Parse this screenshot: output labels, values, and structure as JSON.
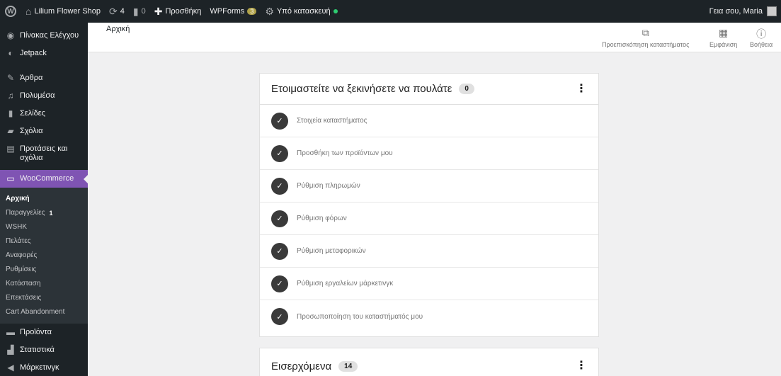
{
  "adminbar": {
    "site_name": "Lilium Flower Shop",
    "updates_count": "4",
    "comments_count": "0",
    "new_label": "Προσθήκη",
    "wpforms_label": "WPForms",
    "wpforms_count": "3",
    "maintenance_label": "Υπό κατασκευή",
    "greeting": "Γεια σου, Maria"
  },
  "sidebar": {
    "items_top": [
      {
        "label": "Πίνακας Ελέγχου",
        "icon": "dashboard-icon"
      },
      {
        "label": "Jetpack",
        "icon": "jetpack-icon"
      }
    ],
    "items_mid": [
      {
        "label": "Άρθρα",
        "icon": "pin-icon"
      },
      {
        "label": "Πολυμέσα",
        "icon": "media-icon"
      },
      {
        "label": "Σελίδες",
        "icon": "pages-icon"
      },
      {
        "label": "Σχόλια",
        "icon": "comments-icon"
      },
      {
        "label": "Προτάσεις και σχόλια",
        "icon": "feedback-icon"
      }
    ],
    "woocommerce_label": "WooCommerce",
    "submenu": [
      {
        "label": "Αρχική"
      },
      {
        "label": "Παραγγελίες",
        "count": "1"
      },
      {
        "label": "WSHK"
      },
      {
        "label": "Πελάτες"
      },
      {
        "label": "Αναφορές"
      },
      {
        "label": "Ρυθμίσεις"
      },
      {
        "label": "Κατάσταση"
      },
      {
        "label": "Επεκτάσεις"
      },
      {
        "label": "Cart Abandonment"
      }
    ],
    "items_bottom": [
      {
        "label": "Προϊόντα",
        "icon": "products-icon"
      },
      {
        "label": "Στατιστικά",
        "icon": "stats-icon"
      },
      {
        "label": "Μάρκετινγκ",
        "icon": "marketing-icon"
      }
    ]
  },
  "header": {
    "breadcrumb": "Αρχική",
    "preview_label": "Προεπισκόπηση καταστήματος",
    "appearance_label": "Εμφάνιση",
    "help_label": "Βοήθεια"
  },
  "setup_card": {
    "title": "Ετοιμαστείτε να ξεκινήσετε να πουλάτε",
    "count": "0",
    "tasks": [
      "Στοιχεία καταστήματος",
      "Προσθήκη των προϊόντων μου",
      "Ρύθμιση πληρωμών",
      "Ρύθμιση φόρων",
      "Ρύθμιση μεταφορικών",
      "Ρύθμιση εργαλείων μάρκετινγκ",
      "Προσωποποίηση του καταστήματός μου"
    ]
  },
  "inbox_card": {
    "title": "Εισερχόμενα",
    "count": "14"
  },
  "colors": {
    "adminbar_bg": "#1d2327",
    "woocommerce_purple": "#7f54b3",
    "check_bg": "#3a3a3a"
  }
}
